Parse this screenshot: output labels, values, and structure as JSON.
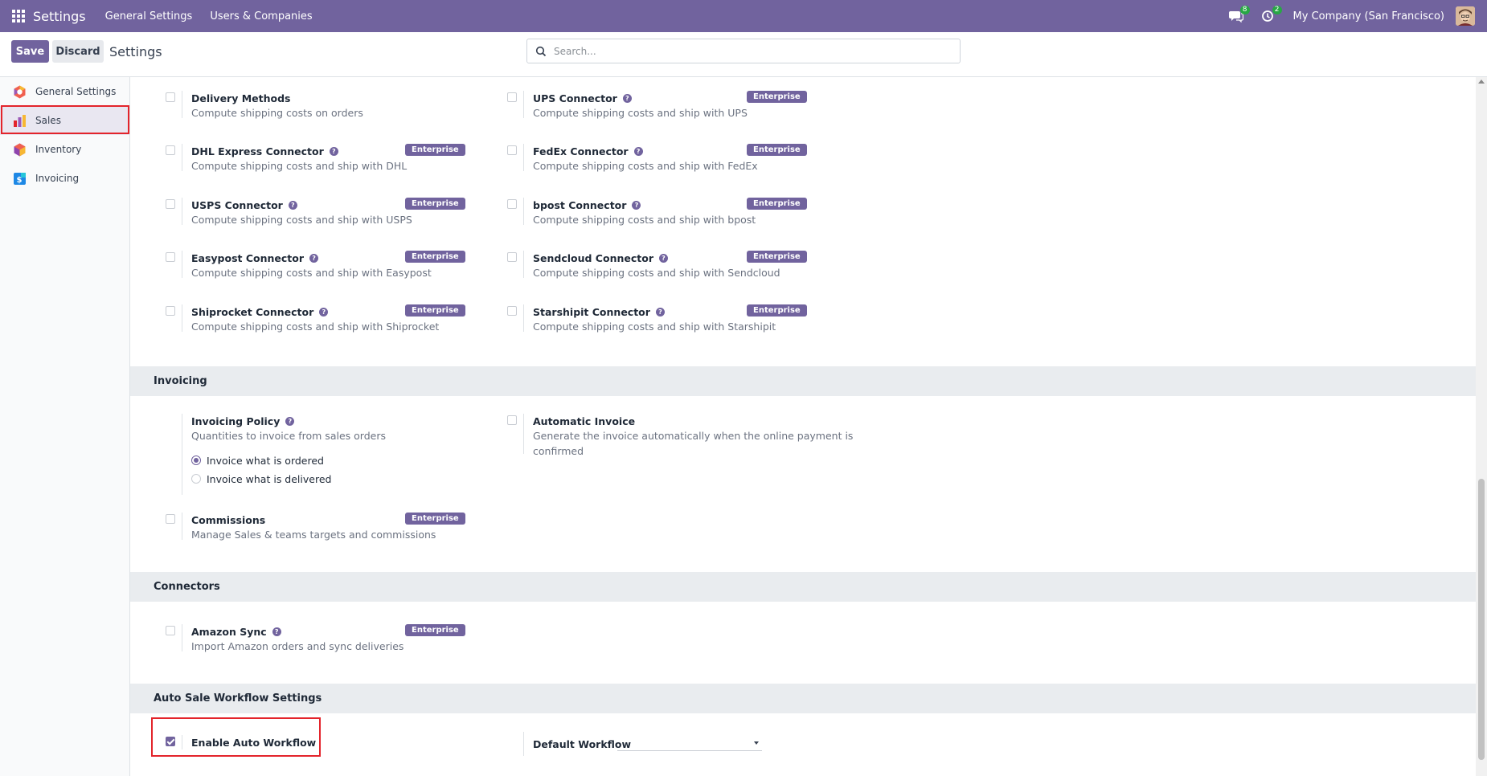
{
  "navbar": {
    "app_name": "Settings",
    "menu": [
      "General Settings",
      "Users & Companies"
    ],
    "messages_count": "8",
    "activities_count": "2",
    "company": "My Company (San Francisco)"
  },
  "control_panel": {
    "save_label": "Save",
    "discard_label": "Discard",
    "title": "Settings",
    "search_placeholder": "Search..."
  },
  "sidebar": {
    "items": [
      {
        "label": "General Settings",
        "icon": "settings-app-icon"
      },
      {
        "label": "Sales",
        "icon": "sales-app-icon",
        "active": true
      },
      {
        "label": "Inventory",
        "icon": "inventory-app-icon"
      },
      {
        "label": "Invoicing",
        "icon": "invoicing-app-icon"
      }
    ]
  },
  "badge_label": "Enterprise",
  "shipping": [
    {
      "title": "Delivery Methods",
      "desc": "Compute shipping costs on orders",
      "help": false,
      "enterprise": false
    },
    {
      "title": "UPS Connector",
      "desc": "Compute shipping costs and ship with UPS",
      "help": true,
      "enterprise": true
    },
    {
      "title": "DHL Express Connector",
      "desc": "Compute shipping costs and ship with DHL",
      "help": true,
      "enterprise": true
    },
    {
      "title": "FedEx Connector",
      "desc": "Compute shipping costs and ship with FedEx",
      "help": true,
      "enterprise": true
    },
    {
      "title": "USPS Connector",
      "desc": "Compute shipping costs and ship with USPS",
      "help": true,
      "enterprise": true
    },
    {
      "title": "bpost Connector",
      "desc": "Compute shipping costs and ship with bpost",
      "help": true,
      "enterprise": true
    },
    {
      "title": "Easypost Connector",
      "desc": "Compute shipping costs and ship with Easypost",
      "help": true,
      "enterprise": true
    },
    {
      "title": "Sendcloud Connector",
      "desc": "Compute shipping costs and ship with Sendcloud",
      "help": true,
      "enterprise": true
    },
    {
      "title": "Shiprocket Connector",
      "desc": "Compute shipping costs and ship with Shiprocket",
      "help": true,
      "enterprise": true
    },
    {
      "title": "Starshipit Connector",
      "desc": "Compute shipping costs and ship with Starshipit",
      "help": true,
      "enterprise": true
    }
  ],
  "invoicing": {
    "header": "Invoicing",
    "policy_title": "Invoicing Policy",
    "policy_desc": "Quantities to invoice from sales orders",
    "options": [
      {
        "label": "Invoice what is ordered",
        "checked": true
      },
      {
        "label": "Invoice what is delivered",
        "checked": false
      }
    ],
    "auto_title": "Automatic Invoice",
    "auto_desc_line1": "Generate the invoice automatically when the online payment is",
    "auto_desc_line2": "confirmed",
    "commissions_title": "Commissions",
    "commissions_desc": "Manage Sales & teams targets and commissions"
  },
  "connectors": {
    "header": "Connectors",
    "amazon_title": "Amazon Sync",
    "amazon_desc": "Import Amazon orders and sync deliveries"
  },
  "workflow": {
    "header": "Auto Sale Workflow Settings",
    "enable_label": "Enable Auto Workflow",
    "enable_checked": true,
    "default_label": "Default Workflow",
    "default_value": ""
  },
  "colors": {
    "brand": "#71639e",
    "highlight": "#e3242b"
  }
}
